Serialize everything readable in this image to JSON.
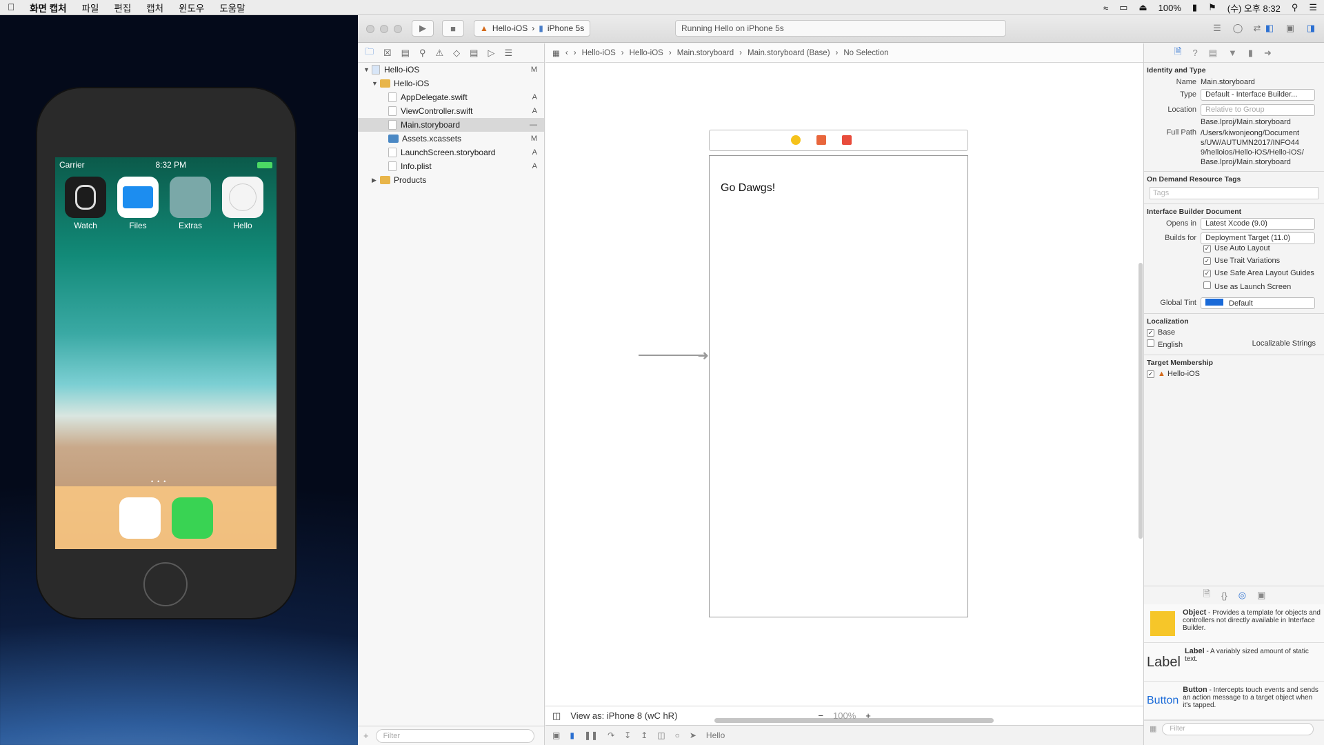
{
  "menubar": {
    "app": "화면 캡처",
    "items": [
      "파일",
      "편집",
      "캡처",
      "윈도우",
      "도움말"
    ],
    "battery": "100%",
    "clock": "(수) 오후 8:32"
  },
  "simulator": {
    "carrier": "Carrier",
    "time": "8:32 PM",
    "apps": [
      {
        "label": "Watch",
        "color": "#1c1c1c"
      },
      {
        "label": "Files",
        "color": "#ffffff"
      },
      {
        "label": "Extras",
        "color": "#7aa8a8"
      },
      {
        "label": "Hello",
        "color": "#f4f4f4"
      }
    ],
    "dock": [
      {
        "name": "safari-icon",
        "color": "#ffffff"
      },
      {
        "name": "messages-icon",
        "color": "#39d353"
      }
    ]
  },
  "toolbar": {
    "scheme": "Hello-iOS",
    "device": "iPhone 5s",
    "activity": "Running Hello on iPhone 5s"
  },
  "navigator": {
    "items": [
      {
        "label": "Hello-iOS",
        "status": "M",
        "indent": 0,
        "type": "project"
      },
      {
        "label": "Hello-iOS",
        "status": "",
        "indent": 1,
        "type": "folder-open"
      },
      {
        "label": "AppDelegate.swift",
        "status": "A",
        "indent": 2,
        "type": "file"
      },
      {
        "label": "ViewController.swift",
        "status": "A",
        "indent": 2,
        "type": "file"
      },
      {
        "label": "Main.storyboard",
        "status": "—",
        "indent": 2,
        "type": "file",
        "selected": true
      },
      {
        "label": "Assets.xcassets",
        "status": "M",
        "indent": 2,
        "type": "assets"
      },
      {
        "label": "LaunchScreen.storyboard",
        "status": "A",
        "indent": 2,
        "type": "file"
      },
      {
        "label": "Info.plist",
        "status": "A",
        "indent": 2,
        "type": "file"
      },
      {
        "label": "Products",
        "status": "",
        "indent": 1,
        "type": "folder"
      }
    ],
    "filter_placeholder": "Filter"
  },
  "jumpbar": {
    "crumbs": [
      "Hello-iOS",
      "Hello-iOS",
      "Main.storyboard",
      "Main.storyboard (Base)",
      "No Selection"
    ]
  },
  "canvas": {
    "label_text": "Go Dawgs!"
  },
  "viewas": {
    "text": "View as: iPhone 8 (wC hR)",
    "zoom": "100%"
  },
  "debug": {
    "target": "Hello"
  },
  "inspector": {
    "identity_title": "Identity and Type",
    "name_k": "Name",
    "name": "Main.storyboard",
    "type_k": "Type",
    "type": "Default - Interface Builder...",
    "location_k": "Location",
    "location": "Relative to Group",
    "location_path": "Base.lproj/Main.storyboard",
    "fullpath_k": "Full Path",
    "fullpath": "/Users/kiwonjeong/Documents/UW/AUTUMN2017/INFO449/helloios/Hello-iOS/Hello-iOS/Base.lproj/Main.storyboard",
    "odr_title": "On Demand Resource Tags",
    "tags_placeholder": "Tags",
    "ib_title": "Interface Builder Document",
    "opens_k": "Opens in",
    "opens": "Latest Xcode (9.0)",
    "builds_k": "Builds for",
    "builds": "Deployment Target (11.0)",
    "checks": [
      {
        "label": "Use Auto Layout",
        "on": true
      },
      {
        "label": "Use Trait Variations",
        "on": true
      },
      {
        "label": "Use Safe Area Layout Guides",
        "on": true
      },
      {
        "label": "Use as Launch Screen",
        "on": false
      }
    ],
    "tint_k": "Global Tint",
    "tint": "Default",
    "tint_color": "#1a6ad8",
    "loc_title": "Localization",
    "loc": [
      {
        "label": "Base",
        "on": true
      },
      {
        "label": "English",
        "on": false,
        "extra": "Localizable Strings"
      }
    ],
    "tm_title": "Target Membership",
    "tm": "Hello-iOS",
    "library": [
      {
        "title": "Object",
        "desc": " - Provides a template for objects and controllers not directly available in Interface Builder."
      },
      {
        "title": "Label",
        "desc": " - A variably sized amount of static text."
      },
      {
        "title": "Button",
        "desc": " - Intercepts touch events and sends an action message to a target object when it's tapped."
      }
    ],
    "lib_filter": "Filter"
  }
}
